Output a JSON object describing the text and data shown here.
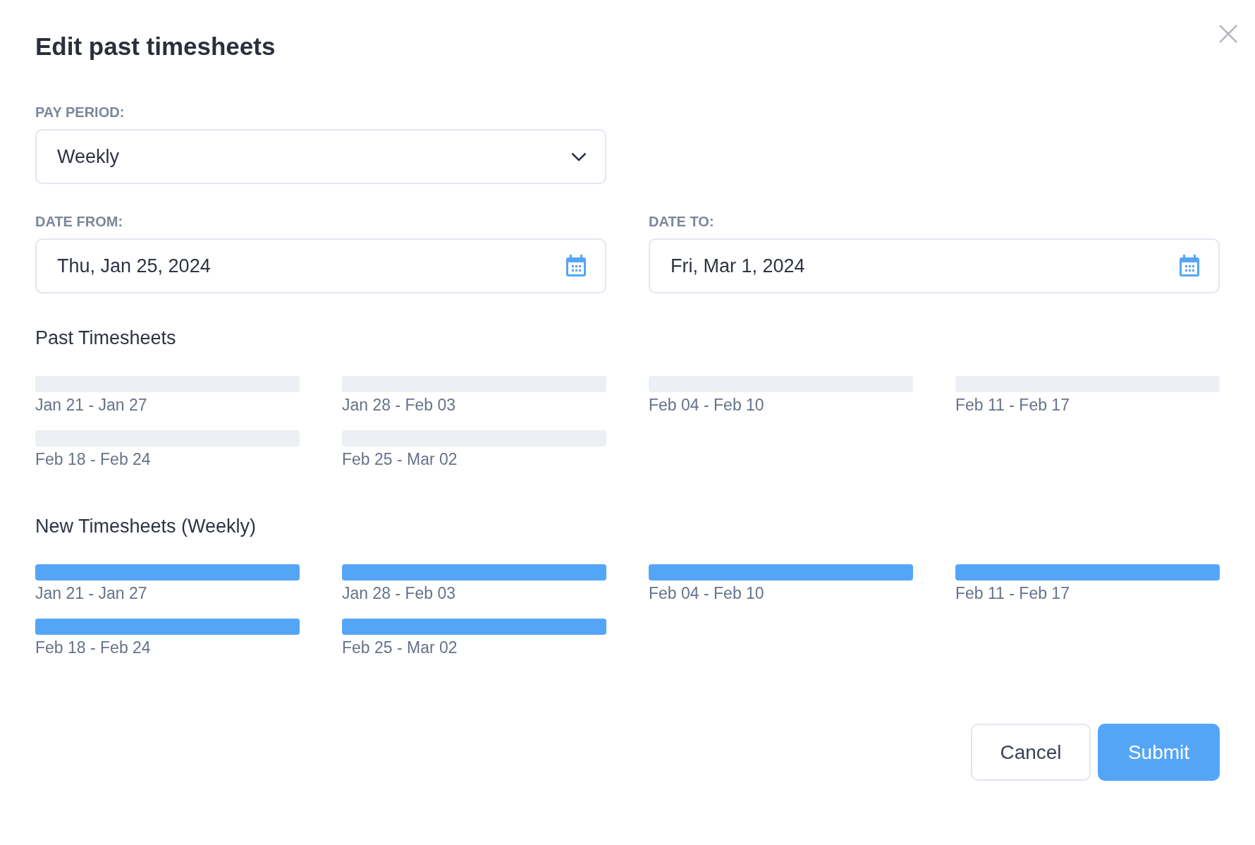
{
  "dialog": {
    "title": "Edit past timesheets"
  },
  "pay_period": {
    "label": "PAY PERIOD:",
    "value": "Weekly"
  },
  "date_from": {
    "label": "DATE FROM:",
    "value": "Thu, Jan 25, 2024"
  },
  "date_to": {
    "label": "DATE TO:",
    "value": "Fri, Mar 1, 2024"
  },
  "sections": [
    {
      "heading": "Past Timesheets",
      "kind": "past",
      "items": [
        "Jan 21 - Jan 27",
        "Jan 28 - Feb 03",
        "Feb 04 - Feb 10",
        "Feb 11 - Feb 17",
        "Feb 18 - Feb 24",
        "Feb 25 - Mar 02"
      ]
    },
    {
      "heading": "New Timesheets (Weekly)",
      "kind": "new",
      "items": [
        "Jan 21 - Jan 27",
        "Jan 28 - Feb 03",
        "Feb 04 - Feb 10",
        "Feb 11 - Feb 17",
        "Feb 18 - Feb 24",
        "Feb 25 - Mar 02"
      ]
    }
  ],
  "buttons": {
    "cancel": "Cancel",
    "submit": "Submit"
  }
}
